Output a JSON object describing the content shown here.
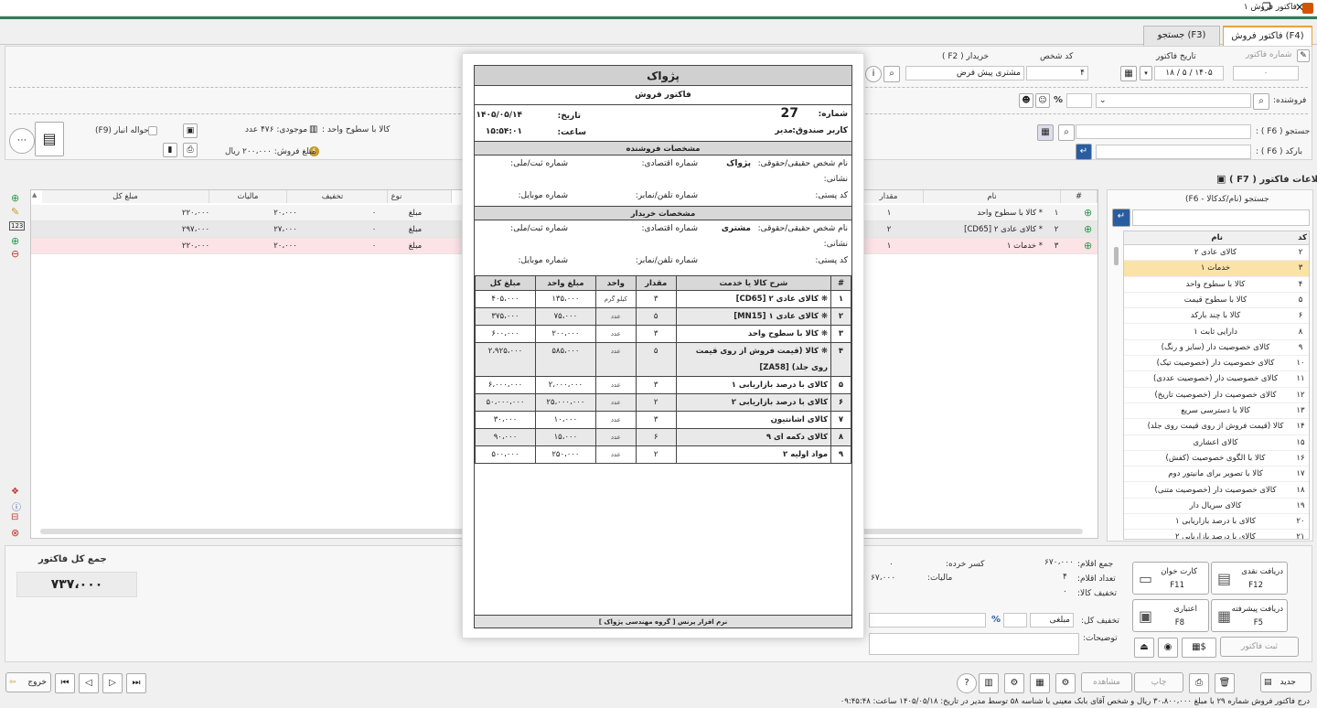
{
  "window": {
    "title": "فاکتور فروش ۱",
    "controls": [
      "❐",
      "✕"
    ]
  },
  "tabs": [
    {
      "label": "فاکتور فروش (F4)",
      "active": true
    },
    {
      "label": "جستجو (F3)",
      "active": false
    }
  ],
  "header": {
    "invoice_number_label": "شماره فاکتور",
    "invoice_number": "۰",
    "date_label": "تاریخ فاکتور",
    "date": "۱۴۰۵ / ۵ / ۱۸",
    "person_code_label": "کد شخص",
    "person_code": "۴",
    "buyer_label": "خریدار ( F2 )",
    "buyer": "مشتری پیش فرض",
    "seller_label": "فروشنده:",
    "percent_sign": "%"
  },
  "search": {
    "search_label": "جستجو ( F6 ) :",
    "barcode_label": "بارکد ( F6 ) :"
  },
  "product_info": {
    "stock_label": "موجودی: ۴۷۶ عدد",
    "item_label": "کالا با سطوح واحد :",
    "warehouse_label": "حواله انبار (F9)",
    "sale_amount_label": "مبلغ فروش: ۲۰۰،۰۰۰ ریال"
  },
  "invoice_info_title": "اطلاعات فاکتور ( F7 )",
  "main_grid": {
    "headers": [
      "#",
      "نام",
      "مقدار",
      "نوع",
      "تخفیف",
      "مالیات",
      "مبلغ کل"
    ],
    "rows": [
      {
        "num": "۱",
        "name": "* کالا با سطوح واحد",
        "qty": "۱",
        "type": "مبلغ",
        "disc": "۰",
        "tax": "۲۰،۰۰۰",
        "total": "۲۲۰،۰۰۰"
      },
      {
        "num": "۲",
        "name": "* کالای عادی ۲ [CD65]",
        "qty": "۲",
        "type": "مبلغ",
        "disc": "۰",
        "tax": "۲۷،۰۰۰",
        "total": "۲۹۷،۰۰۰"
      },
      {
        "num": "۳",
        "name": "* خدمات ۱",
        "qty": "۱",
        "type": "مبلغ",
        "disc": "۰",
        "tax": "۲۰،۰۰۰",
        "total": "۲۲۰،۰۰۰"
      }
    ]
  },
  "product_list": {
    "search_label": "جستجو (نام/کدکالا - F6)",
    "headers": {
      "code": "کد",
      "name": "نام"
    },
    "items": [
      {
        "code": "۲",
        "name": "کالای عادی ۲"
      },
      {
        "code": "۳",
        "name": "خدمات ۱",
        "selected": true
      },
      {
        "code": "۴",
        "name": "کالا با سطوح واحد"
      },
      {
        "code": "۵",
        "name": "کالا با سطوح قیمت"
      },
      {
        "code": "۶",
        "name": "کالا با چند بارکد"
      },
      {
        "code": "۸",
        "name": "دارایی ثابت ۱"
      },
      {
        "code": "۹",
        "name": "کالای خصوصیت دار (سایز و رنگ)"
      },
      {
        "code": "۱۰",
        "name": "کالای خصوصیت دار (خصوصیت تیک)"
      },
      {
        "code": "۱۱",
        "name": "کالای خصوصیت دار (خصوصیت عددی)"
      },
      {
        "code": "۱۲",
        "name": "کالای خصوصیت دار (خصوصیت تاریخ)"
      },
      {
        "code": "۱۳",
        "name": "کالا با دسترسی سریع"
      },
      {
        "code": "۱۴",
        "name": "کالا (قیمت فروش از روی قیمت روی جلد)"
      },
      {
        "code": "۱۵",
        "name": "کالای اعشاری"
      },
      {
        "code": "۱۶",
        "name": "کالا با الگوی خصوصیت (کفش)"
      },
      {
        "code": "۱۷",
        "name": "کالا با تصویر برای مانیتور دوم"
      },
      {
        "code": "۱۸",
        "name": "کالای خصوصیت دار (خصوصیت متنی)"
      },
      {
        "code": "۱۹",
        "name": "کالای سریال دار"
      },
      {
        "code": "۲۰",
        "name": "کالای با درصد بازاریابی ۱"
      },
      {
        "code": "۲۱",
        "name": "کالای با درصد بازاریابی ۲"
      }
    ]
  },
  "totals": {
    "grand_total_label": "جمع کل فاکتور",
    "grand_total": "۷۳۷،۰۰۰",
    "retail_deduction_label": "کسر خرده:",
    "retail_deduction": "۰",
    "tax_label": "مالیات:",
    "tax": "۶۷،۰۰۰",
    "items_sum_label": "جمع اقلام:",
    "items_sum": "۶۷۰،۰۰۰",
    "items_count_label": "تعداد اقلام:",
    "items_count": "۴",
    "goods_discount_label": "تخفیف کالا:",
    "goods_discount": "۰",
    "total_discount_label": "تخفیف کل:",
    "discount_type": "مبلغی",
    "discount_percent": "%",
    "notes_label": "توضیحات:"
  },
  "payment_buttons": [
    {
      "label": "دریافت نقدی",
      "key": "F12"
    },
    {
      "label": "کارت خوان",
      "key": "F11"
    },
    {
      "label": "دریافت پیشرفته",
      "key": "F5"
    },
    {
      "label": "اعتباری",
      "key": "F8"
    }
  ],
  "register_invoice": "ثبت فاکتور",
  "toolbar": {
    "new": "جدید",
    "print": "چاپ",
    "view": "مشاهده",
    "exit": "خروج"
  },
  "status_bar": "درج فاکتور فروش شماره ۲۹ با مبلغ ۳۰،۸۰۰،۰۰۰ ریال و شخص آقای بابک معینی با شناسه ۵۸ توسط مدیر در تاریخ: ۱۴۰۵/۰۵/۱۸ ساعت: ۰۹:۴۵:۴۸",
  "report": {
    "company": "پژواک",
    "doc_title": "فاکتور فروش",
    "number_label": "شماره:",
    "number": "27",
    "date_label": "تاریخ:",
    "date": "۱۴۰۵/۰۵/۱۴",
    "cashier_label": "کاربر صندوق:",
    "cashier": "مدیر",
    "time_label": "ساعت:",
    "time": "۱۵:۵۴:۰۱",
    "seller_section": "مشخصات فروشنده",
    "buyer_section": "مشخصات خریدار",
    "f_name": "نام شخص حقیقی/حقوقی:",
    "f_econ": "شماره اقتصادی:",
    "f_natid": "شماره ثبت/ملی:",
    "f_address": "نشانی:",
    "f_postal": "کد پستی:",
    "f_phone": "شماره تلفن/نمابر:",
    "f_mobile": "شماره موبایل:",
    "seller_name": "پژواک",
    "buyer_name": "مشتری",
    "table_headers": [
      "#",
      "شرح کالا یا خدمت",
      "مقدار",
      "واحد",
      "مبلغ واحد",
      "مبلغ کل"
    ],
    "rows": [
      {
        "n": "۱",
        "desc": "❋ کالای عادی ۲ [CD65]",
        "qty": "۳",
        "unit": "کیلو گرم",
        "price": "۱۳۵،۰۰۰",
        "total": "۴۰۵،۰۰۰"
      },
      {
        "n": "۲",
        "desc": "❋ کالای عادی ۱ [MN15]",
        "qty": "۵",
        "unit": "عدد",
        "price": "۷۵،۰۰۰",
        "total": "۳۷۵،۰۰۰"
      },
      {
        "n": "۳",
        "desc": "❋ کالا با سطوح واحد",
        "qty": "۳",
        "unit": "عدد",
        "price": "۲۰۰،۰۰۰",
        "total": "۶۰۰،۰۰۰"
      },
      {
        "n": "۴",
        "desc": "❋ کالا (قیمت فروش از روی قیمت روی جلد) [ZA58]",
        "qty": "۵",
        "unit": "عدد",
        "price": "۵۸۵،۰۰۰",
        "total": "۲،۹۲۵،۰۰۰"
      },
      {
        "n": "۵",
        "desc": "کالای با درصد بازاریابی ۱",
        "qty": "۳",
        "unit": "عدد",
        "price": "۲،۰۰۰،۰۰۰",
        "total": "۶،۰۰۰،۰۰۰"
      },
      {
        "n": "۶",
        "desc": "کالای با درصد بازاریابی ۲",
        "qty": "۲",
        "unit": "عدد",
        "price": "۲۵،۰۰۰،۰۰۰",
        "total": "۵۰،۰۰۰،۰۰۰"
      },
      {
        "n": "۷",
        "desc": "کالای اشانتیون",
        "qty": "۳",
        "unit": "عدد",
        "price": "۱۰،۰۰۰",
        "total": "۳۰،۰۰۰"
      },
      {
        "n": "۸",
        "desc": "کالای دکمه ای ۹",
        "qty": "۶",
        "unit": "عدد",
        "price": "۱۵،۰۰۰",
        "total": "۹۰،۰۰۰"
      },
      {
        "n": "۹",
        "desc": "مواد اولیه ۲",
        "qty": "۲",
        "unit": "عدد",
        "price": "۲۵۰،۰۰۰",
        "total": "۵۰۰،۰۰۰"
      }
    ],
    "footer": "نرم افزار پرنس [ گروه مهندسی پژواک ]"
  }
}
